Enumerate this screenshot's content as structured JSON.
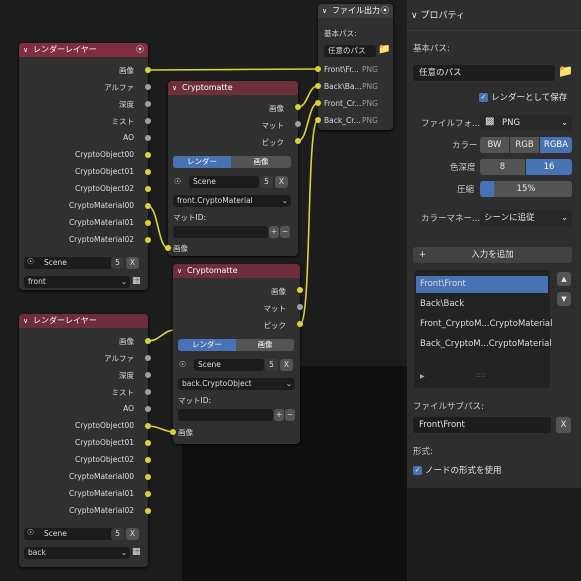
{
  "file_output_node": {
    "title": "ファイル出力",
    "base_path_label": "基本パス:",
    "base_path_value": "任意のパス",
    "outputs": [
      {
        "label": "Front\\Fr...",
        "format": "PNG"
      },
      {
        "label": "Back\\Ba...",
        "format": "PNG"
      },
      {
        "label": "Front_Cr...",
        "format": "PNG"
      },
      {
        "label": "Back_Cr...",
        "format": "PNG"
      }
    ]
  },
  "render_layer_front": {
    "title": "レンダーレイヤー",
    "outputs": [
      "画像",
      "アルファ",
      "深度",
      "ミスト",
      "AO",
      "CryptoObject00",
      "CryptoObject01",
      "CryptoObject02",
      "CryptoMaterial00",
      "CryptoMaterial01",
      "CryptoMaterial02"
    ],
    "scene": "Scene",
    "scene_users": "5",
    "layer": "front"
  },
  "render_layer_back": {
    "title": "レンダーレイヤー",
    "outputs": [
      "画像",
      "アルファ",
      "深度",
      "ミスト",
      "AO",
      "CryptoObject00",
      "CryptoObject01",
      "CryptoObject02",
      "CryptoMaterial00",
      "CryptoMaterial01",
      "CryptoMaterial02"
    ],
    "scene": "Scene",
    "scene_users": "5",
    "layer": "back"
  },
  "cryptomatte_front": {
    "title": "Cryptomatte",
    "outputs": [
      "画像",
      "マット",
      "ピック"
    ],
    "tab_render": "レンダー",
    "tab_image": "画像",
    "scene": "Scene",
    "scene_users": "5",
    "layer": "front.CryptoMaterial",
    "matte_id_label": "マットID:",
    "input_label": "画像"
  },
  "cryptomatte_back": {
    "title": "Cryptomatte",
    "outputs": [
      "画像",
      "マット",
      "ピック"
    ],
    "tab_render": "レンダー",
    "tab_image": "画像",
    "scene": "Scene",
    "scene_users": "5",
    "layer": "back.CryptoObject",
    "matte_id_label": "マットID:",
    "input_label": "画像"
  },
  "properties": {
    "title": "プロパティ",
    "base_path_label": "基本パス:",
    "base_path_value": "任意のパス",
    "save_as_render": "レンダーとして保存",
    "file_format_label": "ファイルフォ...",
    "file_format_value": "PNG",
    "color_label": "カラー",
    "color_options": [
      "BW",
      "RGB",
      "RGBA"
    ],
    "color_selected": "RGBA",
    "depth_label": "色深度",
    "depth_options": [
      "8",
      "16"
    ],
    "depth_selected": "16",
    "compression_label": "圧縮",
    "compression_value": "15%",
    "compression_fraction": 0.15,
    "color_management_label": "カラーマネー...",
    "color_management_value": "シーンに追従",
    "add_input_label": "入力を追加",
    "add_icon": "+",
    "inputs": [
      "Front\\Front",
      "Back\\Back",
      "Front_CryptoM...CryptoMaterial",
      "Back_CryptoM...CryptoMaterial"
    ],
    "selected_input": 0,
    "file_subpath_label": "ファイルサブパス:",
    "file_subpath_value": "Front\\Front",
    "clear_label": "X",
    "format_label": "形式:",
    "use_node_format": "ノードの形式を使用"
  },
  "colors": {
    "accent": "#4772b3",
    "socket_color": "#d8d434",
    "socket_value": "#a1a1a1",
    "render_layer_header": "#7f2e3d",
    "node_body": "#303030"
  }
}
